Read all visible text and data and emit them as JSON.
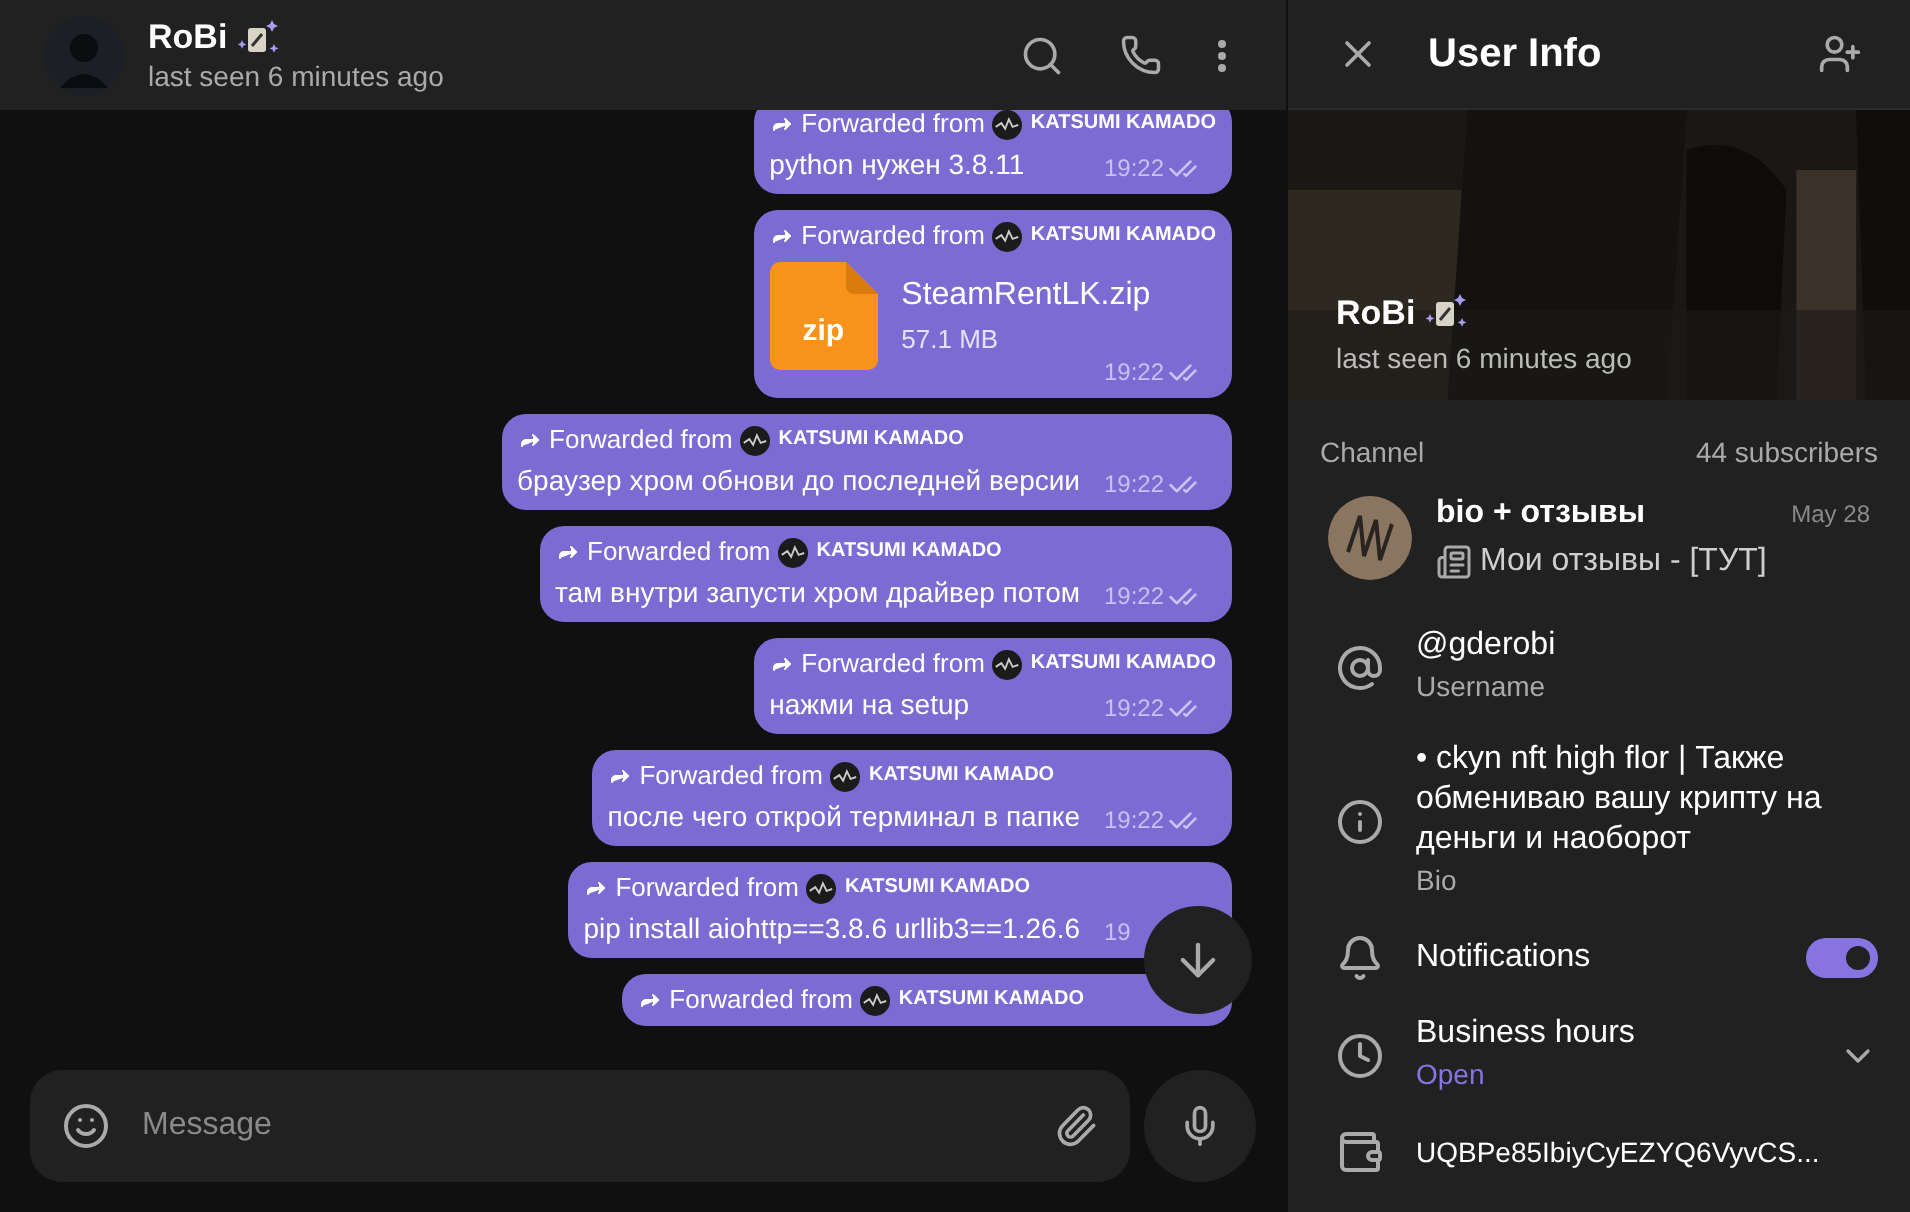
{
  "chat_header": {
    "name": "RoBi",
    "status": "last seen 6 minutes ago"
  },
  "messages": [
    {
      "kind": "text",
      "forwarded_label": "Forwarded from",
      "forwarded_name": "KATSUMI KAMADO",
      "text": "python нужен 3.8.11",
      "time": "19:22",
      "read": true
    },
    {
      "kind": "file",
      "forwarded_label": "Forwarded from",
      "forwarded_name": "KATSUMI KAMADO",
      "file_ext": "zip",
      "file_name": "SteamRentLK.zip",
      "file_size": "57.1 MB",
      "time": "19:22",
      "read": true
    },
    {
      "kind": "text",
      "forwarded_label": "Forwarded from",
      "forwarded_name": "KATSUMI KAMADO",
      "text": "браузер хром обнови до последней версии",
      "time": "19:22",
      "read": true
    },
    {
      "kind": "text",
      "forwarded_label": "Forwarded from",
      "forwarded_name": "KATSUMI KAMADO",
      "text": "там внутри запусти хром драйвер потом",
      "time": "19:22",
      "read": true
    },
    {
      "kind": "text",
      "forwarded_label": "Forwarded from",
      "forwarded_name": "KATSUMI KAMADO",
      "text": "нажми на setup",
      "time": "19:22",
      "read": true
    },
    {
      "kind": "text",
      "forwarded_label": "Forwarded from",
      "forwarded_name": "KATSUMI KAMADO",
      "text": "после чего открой терминал в папке",
      "time": "19:22",
      "read": true
    },
    {
      "kind": "text",
      "forwarded_label": "Forwarded from",
      "forwarded_name": "KATSUMI KAMADO",
      "text": "pip install aiohttp==3.8.6 urllib3==1.26.6",
      "time": "19"
    },
    {
      "kind": "text",
      "forwarded_label": "Forwarded from",
      "forwarded_name": "KATSUMI KAMADO"
    }
  ],
  "composer": {
    "placeholder": "Message"
  },
  "user_info": {
    "title": "User Info",
    "name": "RoBi",
    "status": "last seen 6 minutes ago",
    "channel": {
      "label": "Channel",
      "subscribers": "44 subscribers",
      "title": "bio + отзывы",
      "date": "May 28",
      "preview": "Мои отзывы - [ТУТ]"
    },
    "rows": [
      {
        "kind": "username",
        "value": "@gderobi",
        "caption": "Username"
      },
      {
        "kind": "bio",
        "value": "• ckyn nft high flor | Также обмениваю вашу крипту на деньги и наоборот",
        "caption": "Bio"
      },
      {
        "kind": "notifications",
        "value": "Notifications",
        "on": true
      },
      {
        "kind": "hours",
        "value": "Business hours",
        "caption": "Open",
        "expanded": false
      },
      {
        "kind": "wallet",
        "value": "UQBPe85IbiyCyEZYQ6VyvCS..."
      }
    ]
  }
}
